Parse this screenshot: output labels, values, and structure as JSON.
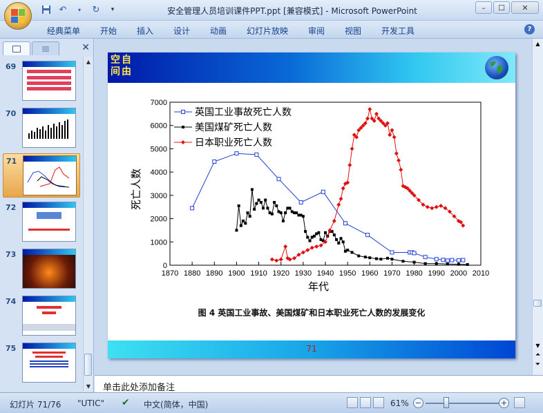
{
  "window": {
    "title": "安全管理人员培训课件PPT.ppt [兼容模式] - Microsoft PowerPoint"
  },
  "ribbon": {
    "tabs": [
      "经典菜单",
      "开始",
      "插入",
      "设计",
      "动画",
      "幻灯片放映",
      "审阅",
      "视图",
      "开发工具"
    ]
  },
  "thumbnails": [
    {
      "num": "69"
    },
    {
      "num": "70"
    },
    {
      "num": "71"
    },
    {
      "num": "72"
    },
    {
      "num": "73"
    },
    {
      "num": "74"
    },
    {
      "num": "75"
    }
  ],
  "slide": {
    "header_line1": "空自",
    "header_line2": "间由",
    "caption": "图 4  英国工业事故、美国煤矿和日本职业死亡人数的发展变化",
    "page_number": "71"
  },
  "notes": {
    "placeholder": "单击此处添加备注"
  },
  "statusbar": {
    "slide_info": "幻灯片 71/76",
    "theme": "\"UTIC\"",
    "language": "中文(简体，中国)",
    "zoom": "61%"
  },
  "chart_data": {
    "type": "line",
    "xlabel": "年代",
    "ylabel": "死亡人数",
    "xlim": [
      1870,
      2010
    ],
    "ylim": [
      0,
      7000
    ],
    "x_ticks": [
      1870,
      1880,
      1890,
      1900,
      1910,
      1920,
      1930,
      1940,
      1950,
      1960,
      1970,
      1980,
      1990,
      2000,
      2010
    ],
    "y_ticks": [
      0,
      1000,
      2000,
      3000,
      4000,
      5000,
      6000,
      7000
    ],
    "legend_position": "top-left",
    "series": [
      {
        "name": "英国工业事故死亡人数",
        "color": "#1f3fd6",
        "marker": "open-square",
        "x": [
          1880,
          1890,
          1900,
          1909,
          1919,
          1929,
          1939,
          1949,
          1959,
          1970,
          1978,
          1979,
          1980,
          1985,
          1990,
          1993,
          1995,
          1997,
          2000,
          2002
        ],
        "y": [
          2450,
          4450,
          4800,
          4750,
          3700,
          2700,
          3150,
          1800,
          1300,
          550,
          550,
          550,
          520,
          350,
          260,
          230,
          200,
          220,
          210,
          220
        ]
      },
      {
        "name": "美国煤矿死亡人数",
        "color": "#000000",
        "marker": "filled-square",
        "x": [
          1900,
          1901,
          1902,
          1903,
          1904,
          1905,
          1906,
          1907,
          1908,
          1909,
          1910,
          1911,
          1912,
          1913,
          1914,
          1915,
          1916,
          1917,
          1918,
          1919,
          1920,
          1921,
          1922,
          1923,
          1924,
          1925,
          1926,
          1927,
          1928,
          1929,
          1930,
          1931,
          1932,
          1933,
          1934,
          1935,
          1936,
          1937,
          1938,
          1939,
          1940,
          1941,
          1942,
          1943,
          1944,
          1945,
          1946,
          1947,
          1948,
          1949,
          1950,
          1952,
          1955,
          1958,
          1960,
          1963,
          1965,
          1968,
          1970,
          1975,
          1980,
          1985,
          1990,
          1995,
          2000,
          2004
        ],
        "y": [
          1500,
          2550,
          1700,
          1900,
          1800,
          2250,
          2100,
          3250,
          2400,
          2650,
          2800,
          2700,
          2450,
          2800,
          2450,
          2250,
          2200,
          2700,
          2550,
          2300,
          2250,
          1900,
          2250,
          2450,
          2450,
          2300,
          2250,
          2250,
          2150,
          2150,
          2100,
          1450,
          1200,
          1050,
          1200,
          1250,
          1350,
          1400,
          1100,
          1050,
          1400,
          1250,
          1450,
          1450,
          1300,
          1100,
          950,
          1150,
          1000,
          600,
          650,
          550,
          400,
          350,
          320,
          280,
          260,
          300,
          260,
          170,
          130,
          70,
          70,
          50,
          40,
          30
        ]
      },
      {
        "name": "日本职业死亡人数",
        "color": "#e01010",
        "marker": "filled-diamond",
        "x": [
          1916,
          1918,
          1920,
          1922,
          1923,
          1924,
          1926,
          1928,
          1930,
          1932,
          1934,
          1936,
          1938,
          1940,
          1942,
          1944,
          1946,
          1947,
          1948,
          1949,
          1950,
          1951,
          1952,
          1953,
          1954,
          1955,
          1956,
          1957,
          1958,
          1959,
          1960,
          1961,
          1962,
          1963,
          1964,
          1965,
          1966,
          1967,
          1968,
          1969,
          1970,
          1971,
          1972,
          1973,
          1974,
          1975,
          1976,
          1977,
          1978,
          1979,
          1980,
          1982,
          1984,
          1986,
          1988,
          1990,
          1992,
          1994,
          1996,
          1998,
          2000,
          2001,
          2002
        ],
        "y": [
          250,
          200,
          250,
          800,
          300,
          250,
          300,
          450,
          550,
          650,
          750,
          800,
          850,
          1000,
          1500,
          1900,
          2600,
          2850,
          3300,
          3500,
          3550,
          4300,
          5000,
          5600,
          5500,
          5800,
          5900,
          6000,
          6100,
          6300,
          6700,
          6300,
          6200,
          6500,
          6300,
          6200,
          6100,
          6000,
          6100,
          5600,
          5800,
          5500,
          4800,
          4500,
          4100,
          3400,
          3350,
          3300,
          3200,
          3100,
          3000,
          2800,
          2600,
          2500,
          2450,
          2500,
          2550,
          2450,
          2300,
          2100,
          1900,
          1850,
          1700
        ]
      }
    ]
  }
}
